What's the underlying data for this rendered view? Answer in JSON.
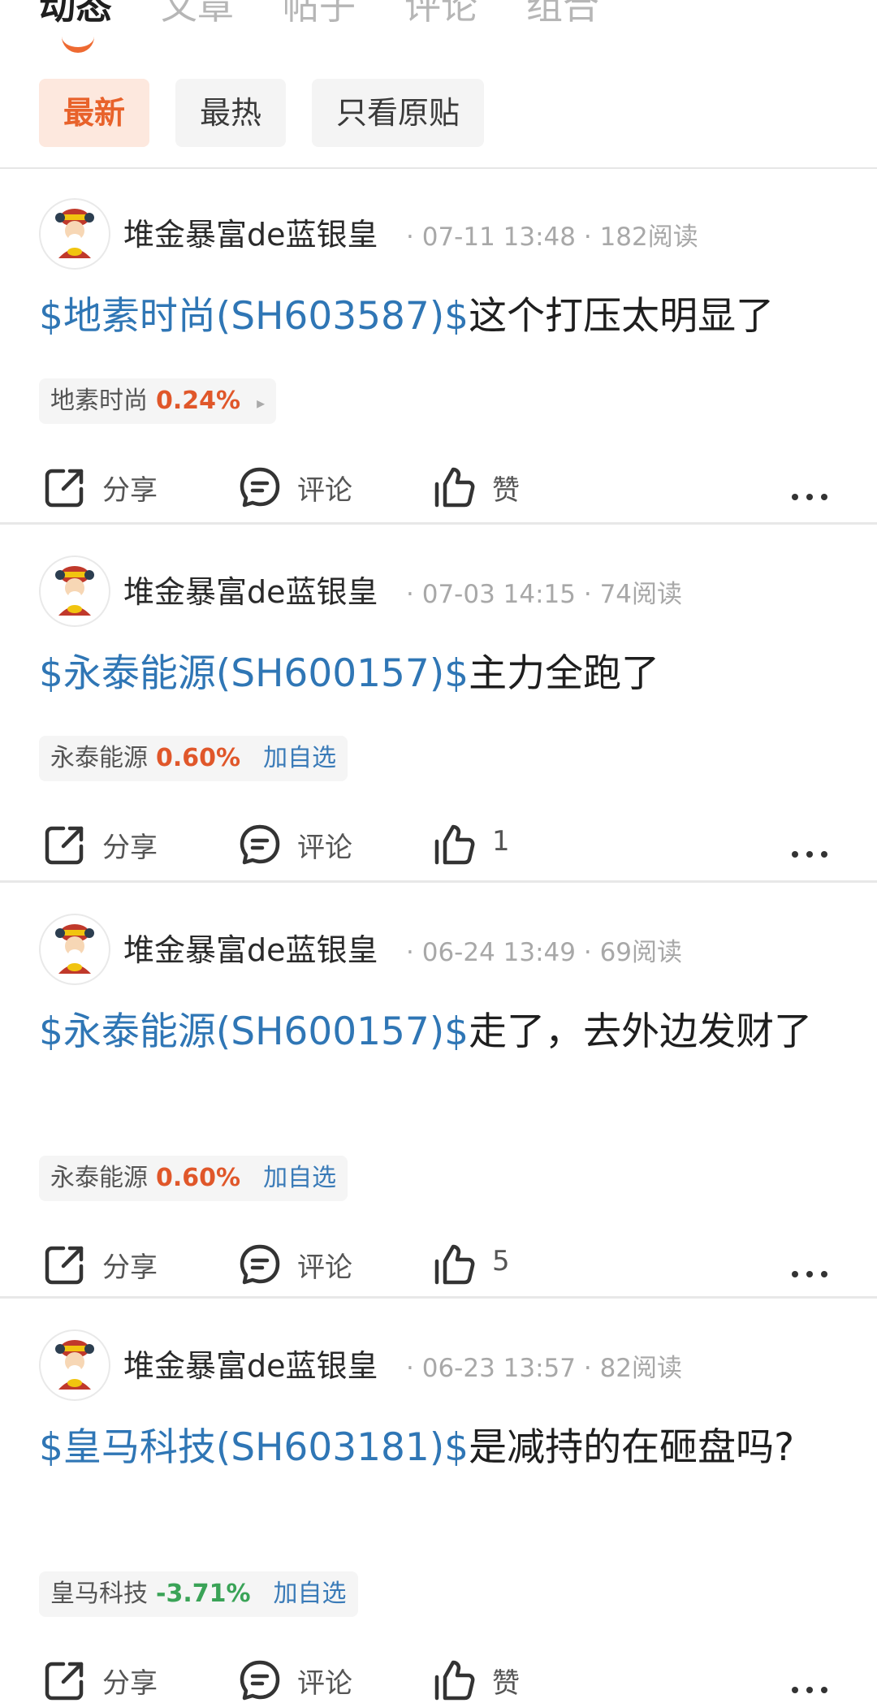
{
  "tabs": [
    {
      "label": "动态",
      "active": true
    },
    {
      "label": "文章",
      "active": false
    },
    {
      "label": "帖子",
      "active": false
    },
    {
      "label": "评论",
      "active": false
    },
    {
      "label": "组合",
      "active": false
    }
  ],
  "filters": [
    {
      "label": "最新",
      "active": true
    },
    {
      "label": "最热",
      "active": false
    },
    {
      "label": "只看原贴",
      "active": false
    }
  ],
  "actions": {
    "share": "分享",
    "comment": "评论"
  },
  "colors": {
    "accent": "#e8622b",
    "stock_link": "#2f76b5",
    "up": "#e0572a",
    "down": "#3aa357"
  },
  "posts": [
    {
      "author": "堆金暴富de蓝银皇",
      "date": "07-11 13:48",
      "reads": "182阅读",
      "stock_tag": "$地素时尚(SH603587)$",
      "text": "这个打压太明显了",
      "chip_name": "地素时尚",
      "chip_pct": "0.24%",
      "chip_action": "▸",
      "like": "赞"
    },
    {
      "author": "堆金暴富de蓝银皇",
      "date": "07-03 14:15",
      "reads": "74阅读",
      "stock_tag": "$永泰能源(SH600157)$",
      "text": "主力全跑了",
      "chip_name": "永泰能源",
      "chip_pct": "0.60%",
      "chip_action": "加自选",
      "like": "1"
    },
    {
      "author": "堆金暴富de蓝银皇",
      "date": "06-24 13:49",
      "reads": "69阅读",
      "stock_tag": "$永泰能源(SH600157)$",
      "text": "走了，去外边发财了",
      "chip_name": "永泰能源",
      "chip_pct": "0.60%",
      "chip_action": "加自选",
      "like": "5"
    },
    {
      "author": "堆金暴富de蓝银皇",
      "date": "06-23 13:57",
      "reads": "82阅读",
      "stock_tag": "$皇马科技(SH603181)$",
      "text": "是减持的在砸盘吗?",
      "chip_name": "皇马科技",
      "chip_pct": "-3.71%",
      "chip_action": "加自选",
      "like": "赞"
    }
  ]
}
